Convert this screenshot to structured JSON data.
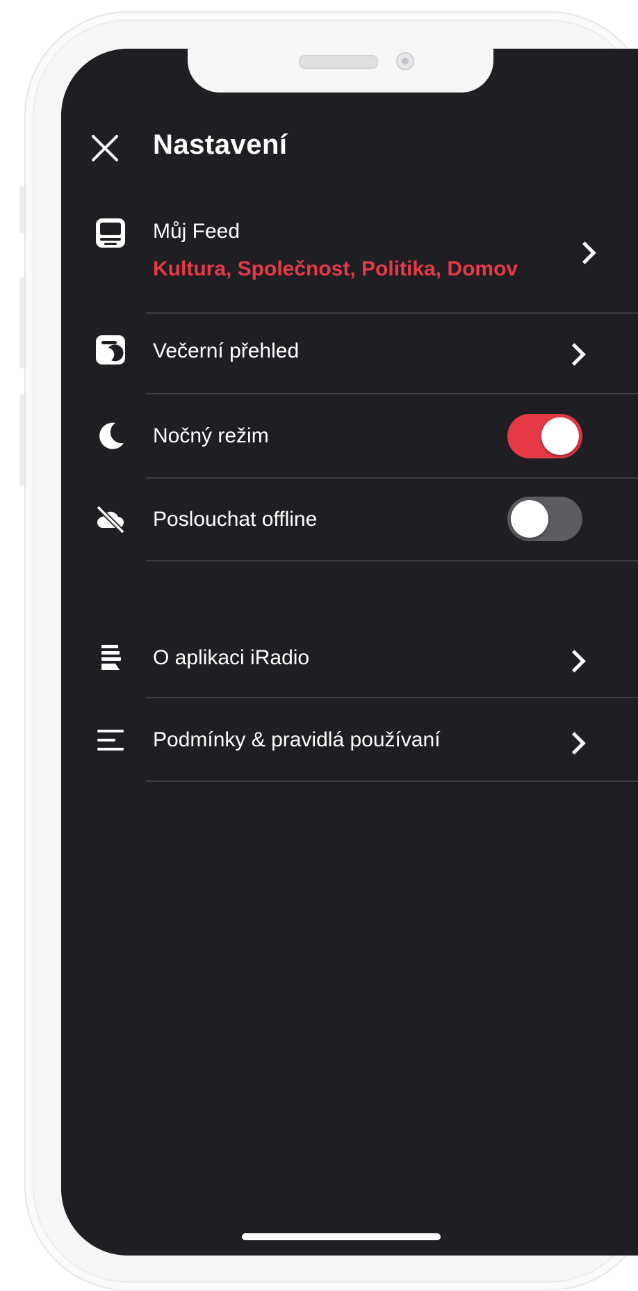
{
  "header": {
    "title": "Nastavení"
  },
  "settings": {
    "feed": {
      "label": "Můj Feed",
      "topics": "Kultura, Společnost, Politika, Domov"
    },
    "evening": {
      "label": "Večerní přehled"
    },
    "night_mode": {
      "label": "Nočný režim",
      "enabled": true
    },
    "offline": {
      "label": "Poslouchat offline",
      "enabled": false
    },
    "about": {
      "label": "O aplikaci iRadio"
    },
    "terms": {
      "label": "Podmínky & pravidlá používaní"
    }
  },
  "colors": {
    "background": "#1f1f23",
    "accent": "#e63946",
    "toggle_off": "#5c5d63",
    "divider": "#3b3b41"
  }
}
